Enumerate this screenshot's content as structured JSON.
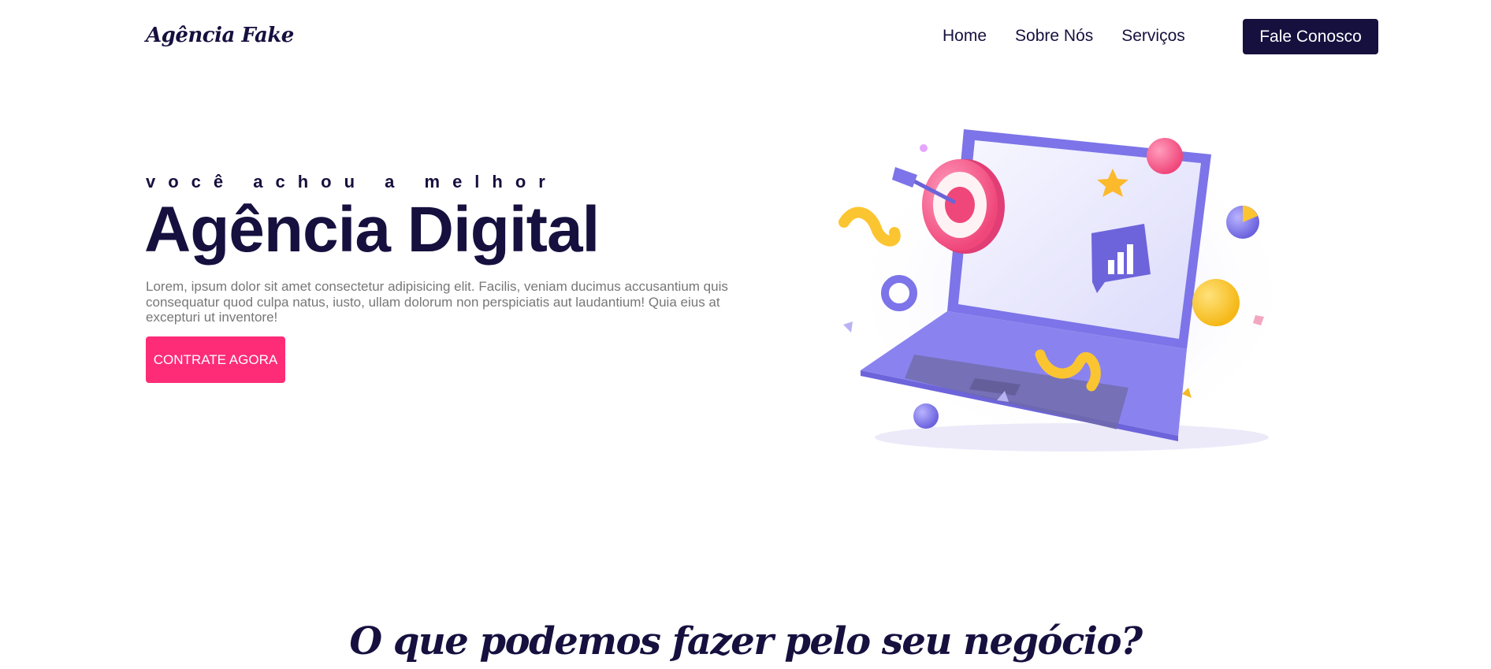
{
  "brand": {
    "logo": "Agência Fake"
  },
  "nav": {
    "items": [
      "Home",
      "Sobre Nós",
      "Serviços"
    ],
    "cta": "Fale Conosco"
  },
  "hero": {
    "tagline": "você achou a melhor",
    "title": "Agência Digital",
    "text": "Lorem, ipsum dolor sit amet consectetur adipisicing elit. Facilis, veniam ducimus accusantium quis consequatur quod culpa natus, iusto, ullam dolorum non perspiciatis aut laudantium! Quia eius at excepturi ut inventore!",
    "cta": "CONTRATE AGORA"
  },
  "section": {
    "title": "O que podemos fazer pelo seu negócio?"
  },
  "colors": {
    "primary": "#16103f",
    "accent": "#fe2c77",
    "laptop": "#7b72e6",
    "yellow": "#fbc531"
  }
}
